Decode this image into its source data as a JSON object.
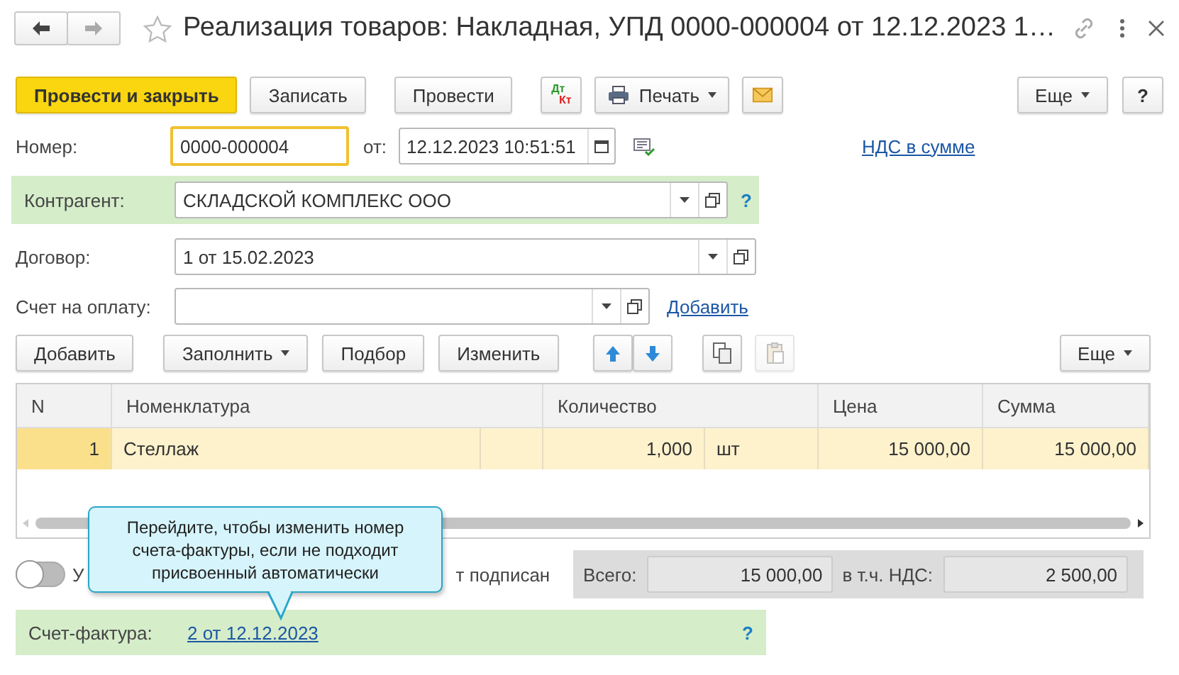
{
  "window": {
    "title": "Реализация товаров: Накладная, УПД 0000-000004 от 12.12.2023 1…"
  },
  "toolbar": {
    "buttons": [
      {
        "kind": "primary",
        "label": "Провести и закрыть"
      },
      {
        "kind": "text",
        "label": "Записать"
      },
      {
        "kind": "text",
        "label": "Провести"
      },
      {
        "kind": "dtkt",
        "label_top": "Дт",
        "label_bottom": "Кт"
      },
      {
        "kind": "print-menu",
        "label": "Печать"
      },
      {
        "kind": "mail"
      }
    ],
    "right_buttons": [
      {
        "kind": "menu",
        "label": "Еще"
      },
      {
        "kind": "text",
        "label": "?"
      }
    ]
  },
  "number": {
    "label": "Номер:",
    "value": "0000-000004",
    "focused": true
  },
  "date": {
    "label": "от:",
    "value": "12.12.2023 10:51:51"
  },
  "vat_link": "НДС в сумме",
  "counterparty": {
    "label": "Контрагент:",
    "value": "СКЛАДСКОЙ КОМПЛЕКС ООО",
    "help": "?",
    "highlighted": true
  },
  "contract": {
    "label": "Договор:",
    "value": "1 от 15.02.2023"
  },
  "payment_invoice": {
    "label": "Счет на оплату:",
    "add_link": "Добавить"
  },
  "table_toolbar": {
    "buttons": [
      {
        "kind": "text",
        "label": "Добавить"
      },
      {
        "kind": "menu",
        "label": "Заполнить"
      },
      {
        "kind": "text",
        "label": "Подбор"
      },
      {
        "kind": "text",
        "label": "Изменить"
      },
      {
        "kind": "move-up"
      },
      {
        "kind": "move-down"
      },
      {
        "kind": "copy",
        "disabled": false
      },
      {
        "kind": "paste",
        "disabled": true
      }
    ],
    "right_buttons": [
      {
        "kind": "menu",
        "label": "Еще"
      }
    ]
  },
  "table": {
    "columns": [
      "N",
      "Номенклатура",
      "Количество",
      "Цена",
      "Сумма"
    ],
    "rows": [
      {
        "n": "1",
        "item": "Стеллаж",
        "quantity": "1,000",
        "unit": "шт",
        "price": "15 000,00",
        "sum": "15 000,00",
        "selected": true
      }
    ]
  },
  "toggle": {
    "on": false,
    "label_parts": [
      "У",
      "т подписан"
    ]
  },
  "totals": {
    "total_label": "Всего:",
    "total": "15 000,00",
    "vat_label": "в т.ч. НДС:",
    "vat": "2 500,00"
  },
  "invoice": {
    "label": "Счет-фактура:",
    "link": "2 от 12.12.2023",
    "help": "?",
    "highlighted": true
  },
  "tooltip": {
    "text": "Перейдите, чтобы изменить номер счета-фактуры, если не подходит присвоенный автоматически"
  }
}
